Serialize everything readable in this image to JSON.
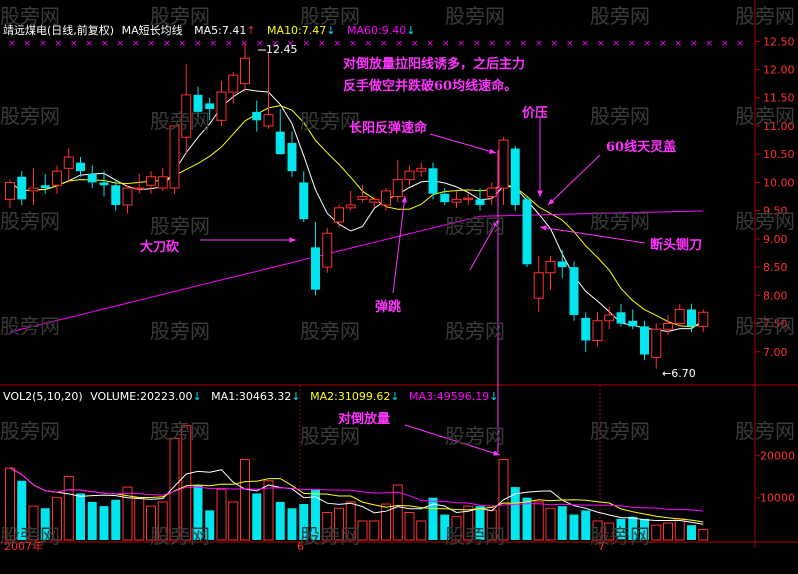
{
  "header": {
    "title": "靖远煤电(日线,前复权)",
    "indicator": "MA短长均线",
    "ma5": "MA5:7.41",
    "ma10": "MA10:7.47",
    "ma60": "MA60:9.40"
  },
  "volume_header": {
    "vol": "VOL2(5,10,20)",
    "volume": "VOLUME:20223.00",
    "ma1": "MA1:30463.32",
    "ma2": "MA2:31099.62",
    "ma3": "MA3:49596.19"
  },
  "annotations": {
    "top1": "对倒放量拉阳线诱多，之后主力",
    "top2": "反手做空并跌破60均线速命。",
    "long_yang": "长阳反弹速命",
    "price_press": "价压",
    "ma60_cover": "60线天灵盖",
    "big_knife": "大刀砍",
    "break_head": "断头铡刀",
    "rebound": "弹跳",
    "vol_note": "对倒放量"
  },
  "price_labels": {
    "high": "12.45",
    "low": "←6.70"
  },
  "x_labels": [
    "2007年",
    "6",
    "7"
  ],
  "watermark": "股旁网",
  "colors": {
    "up": "#ff3030",
    "down": "#00e5ee",
    "ma5": "#ffffff",
    "ma10": "#ffff00",
    "ma60": "#ff00ff",
    "annotation": "#ff33ff",
    "axis": "#b00000"
  },
  "chart_data": {
    "type": "candlestick",
    "price_axis": {
      "ticks": [
        "12.50",
        "12.00",
        "11.50",
        "11.00",
        "10.50",
        "10.00",
        "9.50",
        "9.00",
        "8.50",
        "8.00",
        "7.50",
        "7.00"
      ],
      "ylim": [
        6.5,
        12.7
      ]
    },
    "volume_axis": {
      "ticks": [
        "20000",
        "10000"
      ],
      "ylim": [
        0,
        30000
      ]
    },
    "candles": [
      {
        "o": 9.7,
        "h": 10.05,
        "l": 9.55,
        "c": 10.0
      },
      {
        "o": 10.1,
        "h": 10.2,
        "l": 9.6,
        "c": 9.7
      },
      {
        "o": 9.85,
        "h": 10.25,
        "l": 9.6,
        "c": 9.9
      },
      {
        "o": 9.95,
        "h": 10.15,
        "l": 9.8,
        "c": 9.9
      },
      {
        "o": 9.95,
        "h": 10.3,
        "l": 9.8,
        "c": 10.2
      },
      {
        "o": 10.25,
        "h": 10.6,
        "l": 10.0,
        "c": 10.45
      },
      {
        "o": 10.35,
        "h": 10.45,
        "l": 10.1,
        "c": 10.2
      },
      {
        "o": 10.15,
        "h": 10.3,
        "l": 9.9,
        "c": 10.0
      },
      {
        "o": 10.0,
        "h": 10.2,
        "l": 9.75,
        "c": 9.95
      },
      {
        "o": 9.95,
        "h": 10.05,
        "l": 9.5,
        "c": 9.6
      },
      {
        "o": 9.6,
        "h": 9.95,
        "l": 9.45,
        "c": 9.9
      },
      {
        "o": 9.9,
        "h": 10.15,
        "l": 9.8,
        "c": 9.9
      },
      {
        "o": 9.95,
        "h": 10.2,
        "l": 9.8,
        "c": 10.1
      },
      {
        "o": 9.9,
        "h": 10.25,
        "l": 9.85,
        "c": 10.1
      },
      {
        "o": 9.9,
        "h": 11.0,
        "l": 9.8,
        "c": 11.0
      },
      {
        "o": 10.8,
        "h": 12.1,
        "l": 10.5,
        "c": 11.55
      },
      {
        "o": 11.55,
        "h": 11.7,
        "l": 11.1,
        "c": 11.25
      },
      {
        "o": 11.4,
        "h": 11.5,
        "l": 11.1,
        "c": 11.3
      },
      {
        "o": 11.1,
        "h": 11.8,
        "l": 11.0,
        "c": 11.6
      },
      {
        "o": 11.6,
        "h": 11.95,
        "l": 11.4,
        "c": 11.9
      },
      {
        "o": 11.75,
        "h": 12.45,
        "l": 11.6,
        "c": 12.2
      },
      {
        "o": 11.25,
        "h": 11.45,
        "l": 10.9,
        "c": 11.1
      },
      {
        "o": 11.0,
        "h": 12.3,
        "l": 10.95,
        "c": 11.2
      },
      {
        "o": 10.9,
        "h": 11.3,
        "l": 10.5,
        "c": 10.5
      },
      {
        "o": 10.7,
        "h": 10.9,
        "l": 10.1,
        "c": 10.2
      },
      {
        "o": 10.0,
        "h": 10.2,
        "l": 9.3,
        "c": 9.35
      },
      {
        "o": 8.85,
        "h": 9.3,
        "l": 8.0,
        "c": 8.1
      },
      {
        "o": 8.5,
        "h": 9.2,
        "l": 8.4,
        "c": 9.1
      },
      {
        "o": 9.3,
        "h": 9.6,
        "l": 9.2,
        "c": 9.55
      },
      {
        "o": 9.55,
        "h": 9.85,
        "l": 9.5,
        "c": 9.6
      },
      {
        "o": 9.7,
        "h": 9.95,
        "l": 9.65,
        "c": 9.75
      },
      {
        "o": 9.65,
        "h": 9.75,
        "l": 9.55,
        "c": 9.7
      },
      {
        "o": 9.6,
        "h": 9.9,
        "l": 9.5,
        "c": 9.85
      },
      {
        "o": 9.75,
        "h": 10.4,
        "l": 9.65,
        "c": 10.05
      },
      {
        "o": 10.05,
        "h": 10.3,
        "l": 9.95,
        "c": 10.2
      },
      {
        "o": 10.2,
        "h": 10.35,
        "l": 10.1,
        "c": 10.25
      },
      {
        "o": 10.25,
        "h": 10.35,
        "l": 9.7,
        "c": 9.8
      },
      {
        "o": 9.8,
        "h": 9.9,
        "l": 9.6,
        "c": 9.65
      },
      {
        "o": 9.65,
        "h": 9.85,
        "l": 9.55,
        "c": 9.7
      },
      {
        "o": 9.7,
        "h": 9.8,
        "l": 9.6,
        "c": 9.72
      },
      {
        "o": 9.7,
        "h": 9.9,
        "l": 9.5,
        "c": 9.6
      },
      {
        "o": 9.75,
        "h": 10.0,
        "l": 9.6,
        "c": 9.9
      },
      {
        "o": 9.9,
        "h": 10.8,
        "l": 9.6,
        "c": 10.75
      },
      {
        "o": 10.6,
        "h": 10.65,
        "l": 9.5,
        "c": 9.6
      },
      {
        "o": 9.7,
        "h": 9.75,
        "l": 8.5,
        "c": 8.55
      },
      {
        "o": 7.95,
        "h": 8.7,
        "l": 7.7,
        "c": 8.4
      },
      {
        "o": 8.4,
        "h": 8.7,
        "l": 8.1,
        "c": 8.6
      },
      {
        "o": 8.6,
        "h": 8.8,
        "l": 8.3,
        "c": 8.5
      },
      {
        "o": 8.5,
        "h": 8.6,
        "l": 7.55,
        "c": 7.65
      },
      {
        "o": 7.6,
        "h": 7.7,
        "l": 7.0,
        "c": 7.2
      },
      {
        "o": 7.2,
        "h": 7.7,
        "l": 7.1,
        "c": 7.55
      },
      {
        "o": 7.55,
        "h": 7.8,
        "l": 7.4,
        "c": 7.65
      },
      {
        "o": 7.7,
        "h": 7.85,
        "l": 7.45,
        "c": 7.5
      },
      {
        "o": 7.55,
        "h": 7.75,
        "l": 7.4,
        "c": 7.45
      },
      {
        "o": 7.45,
        "h": 7.55,
        "l": 6.85,
        "c": 6.95
      },
      {
        "o": 6.9,
        "h": 7.5,
        "l": 6.7,
        "c": 7.4
      },
      {
        "o": 7.4,
        "h": 7.65,
        "l": 7.3,
        "c": 7.5
      },
      {
        "o": 7.5,
        "h": 7.85,
        "l": 7.45,
        "c": 7.75
      },
      {
        "o": 7.75,
        "h": 7.85,
        "l": 7.35,
        "c": 7.45
      },
      {
        "o": 7.45,
        "h": 7.75,
        "l": 7.35,
        "c": 7.7
      }
    ],
    "volume": [
      17000,
      14000,
      8000,
      7500,
      10000,
      15000,
      11000,
      9000,
      8000,
      9500,
      12500,
      10000,
      8000,
      9000,
      24000,
      27000,
      13000,
      7000,
      12000,
      9000,
      19000,
      11000,
      14000,
      9000,
      7500,
      8500,
      12000,
      6500,
      7500,
      9000,
      4500,
      4500,
      8500,
      13000,
      6500,
      4500,
      10000,
      6000,
      5500,
      8000,
      8000,
      7000,
      19000,
      12500,
      10000,
      9000,
      7500,
      8000,
      6000,
      7000,
      4500,
      4000,
      5000,
      5500,
      5000,
      3500,
      4000,
      5000,
      3500,
      2500
    ],
    "series": [
      {
        "name": "MA5",
        "value": 7.41
      },
      {
        "name": "MA10",
        "value": 7.47
      },
      {
        "name": "MA60",
        "value": 9.4
      }
    ]
  }
}
